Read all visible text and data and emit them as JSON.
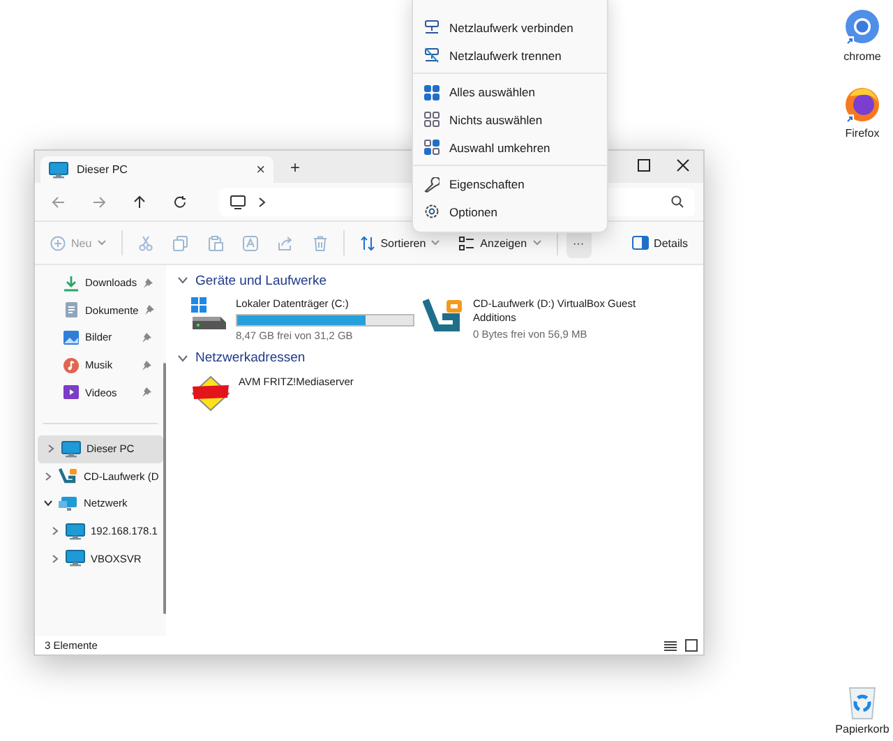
{
  "desktop_icons": [
    {
      "label": "chrome",
      "kind": "chrome"
    },
    {
      "label": "Firefox",
      "kind": "firefox"
    },
    {
      "label": "Papierkorb",
      "kind": "bin"
    }
  ],
  "window": {
    "tab": {
      "title": "Dieser PC",
      "close": "×"
    },
    "new_tab": "+"
  },
  "toolbar": [
    {
      "kind": "new",
      "label": "Neu",
      "disabled": true
    },
    {
      "kind": "cut",
      "disabled": true
    },
    {
      "kind": "copy",
      "disabled": true
    },
    {
      "kind": "paste",
      "disabled": true
    },
    {
      "kind": "rename",
      "disabled": true
    },
    {
      "kind": "share",
      "disabled": true
    },
    {
      "kind": "delete",
      "disabled": true
    },
    {
      "kind": "sort",
      "label": "Sortieren",
      "disabled": false
    },
    {
      "kind": "view",
      "label": "Anzeigen",
      "disabled": false
    },
    {
      "kind": "more",
      "label": "···",
      "disabled": false,
      "selected": true
    },
    {
      "kind": "details",
      "label": "Details",
      "disabled": false
    }
  ],
  "quick_access": [
    {
      "label": "Downloads",
      "kind": "downloads",
      "pinned": true
    },
    {
      "label": "Dokumente",
      "kind": "documents",
      "pinned": true
    },
    {
      "label": "Bilder",
      "kind": "pictures",
      "pinned": true
    },
    {
      "label": "Musik",
      "kind": "music",
      "pinned": true
    },
    {
      "label": "Videos",
      "kind": "videos",
      "pinned": true
    }
  ],
  "tree": [
    {
      "label": "Dieser PC",
      "kind": "pc",
      "selected": true,
      "expanded": false
    },
    {
      "label": "CD-Laufwerk (D",
      "kind": "cd",
      "selected": false,
      "expanded": false
    },
    {
      "label": "Netzwerk",
      "kind": "network",
      "selected": false,
      "expanded": true,
      "children": [
        {
          "label": "192.168.178.1",
          "kind": "pc",
          "selected": false,
          "expanded": false
        },
        {
          "label": "VBOXSVR",
          "kind": "pc",
          "selected": false,
          "expanded": false
        }
      ]
    }
  ],
  "sections": [
    {
      "title": "Geräte und Laufwerke",
      "expanded": true,
      "items": [
        {
          "kind": "disk",
          "name": "Lokaler Datenträger (C:)",
          "level": 0.73,
          "info": "8,47 GB frei von 31,2 GB"
        },
        {
          "kind": "cd",
          "name": "CD-Laufwerk (D:) VirtualBox Guest Additions",
          "info": "0 Bytes frei von 56,9 MB"
        }
      ]
    },
    {
      "title": "Netzwerkadressen",
      "expanded": true,
      "items": [
        {
          "kind": "fritz",
          "name": "AVM FRITZ!Mediaserver"
        }
      ]
    }
  ],
  "status_bar": {
    "text": "3 Elemente"
  },
  "context_menu": [
    [
      {
        "label": "Netzlaufwerk verbinden",
        "kind": "map"
      },
      {
        "label": "Netzlaufwerk trennen",
        "kind": "unmap"
      }
    ],
    [
      {
        "label": "Alles auswählen",
        "kind": "selall"
      },
      {
        "label": "Nichts auswählen",
        "kind": "selnone"
      },
      {
        "label": "Auswahl umkehren",
        "kind": "selinv"
      }
    ],
    [
      {
        "label": "Eigenschaften",
        "kind": "props"
      },
      {
        "label": "Optionen",
        "kind": "options"
      }
    ]
  ]
}
